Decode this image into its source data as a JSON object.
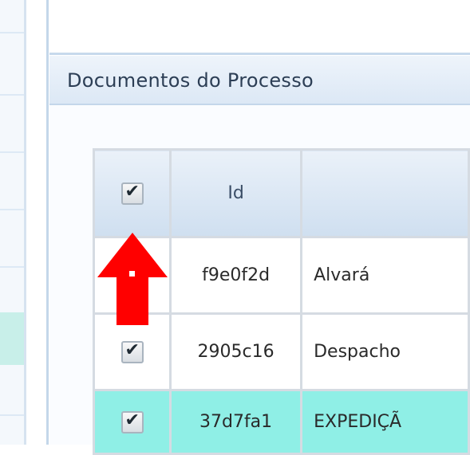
{
  "panel": {
    "title": "Documentos do Processo"
  },
  "table": {
    "headers": {
      "select_all_checked": true,
      "id": "Id",
      "description": ""
    },
    "rows": [
      {
        "id": "f9e0f2d",
        "description": "Alvará",
        "checked": false,
        "highlighted": false
      },
      {
        "id": "2905c16",
        "description": "Despacho",
        "checked": true,
        "highlighted": false
      },
      {
        "id": "37d7fa1",
        "description": "EXPEDIÇÃ",
        "checked": true,
        "highlighted": true
      }
    ]
  },
  "colors": {
    "highlight_row": "#8fefe6",
    "header_gradient_top": "#eaf1f9",
    "header_gradient_bottom": "#cfdff0",
    "annotation_arrow": "#ff0000"
  },
  "annotation": {
    "icon": "red-up-arrow-marker"
  }
}
